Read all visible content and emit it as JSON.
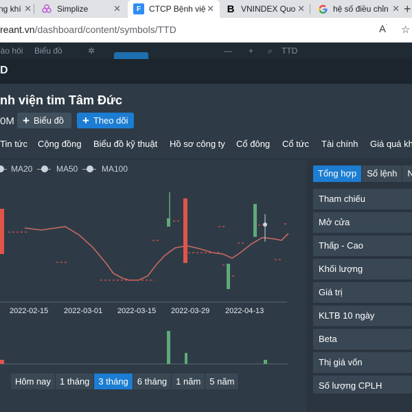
{
  "browser": {
    "tabs": [
      {
        "label": "ng khí",
        "icon": "document-icon",
        "active": false
      },
      {
        "label": "Simplize",
        "icon": "simplize-logo-icon",
        "active": false
      },
      {
        "label": "CTCP Bệnh việ",
        "icon": "f-logo-icon",
        "active": true
      },
      {
        "label": "VNINDEX Quo",
        "icon": "b-logo-icon",
        "active": false
      },
      {
        "label": "hệ số điều chỉn",
        "icon": "google-logo-icon",
        "active": false
      }
    ],
    "url_host": "reant.vn",
    "url_path": "/dashboard/content/symbols/TTD"
  },
  "app_top": {
    "left_text": "nào hôi",
    "right_text": "Biểu đồ",
    "search_text": "TTD"
  },
  "modal": {
    "code_fragment": "D",
    "company_name": "nh viện tim Tâm Đức",
    "price_fragment": "0M",
    "chart_button": "Biểu đồ",
    "follow_button": "Theo dõi",
    "nav": [
      "Tin tức",
      "Cộng đồng",
      "Biểu đồ kỹ thuật",
      "Hồ sơ công ty",
      "Cổ đông",
      "Cổ tức",
      "Tài chính",
      "Giá quá kh"
    ],
    "legend": [
      "MA20",
      "MA50",
      "MA100"
    ],
    "ranges": [
      {
        "label": "Hôm nay",
        "active": false
      },
      {
        "label": "1 tháng",
        "active": false
      },
      {
        "label": "3 tháng",
        "active": true
      },
      {
        "label": "6 tháng",
        "active": false
      },
      {
        "label": "1 năm",
        "active": false
      },
      {
        "label": "5 năm",
        "active": false
      }
    ],
    "right_tabs": [
      {
        "label": "Tổng hợp",
        "active": true
      },
      {
        "label": "Sổ lệnh",
        "active": false
      },
      {
        "label": "N",
        "active": false
      }
    ],
    "stats": [
      "Tham chiếu",
      "Mở cửa",
      "Thấp - Cao",
      "Khối lượng",
      "Giá trị",
      "KLTB 10 ngày",
      "Beta",
      "Thị giá vốn",
      "Số lượng CPLH"
    ]
  },
  "chart_data": {
    "type": "candlestick",
    "x_tick_labels": [
      "2022-02-15",
      "2022-03-01",
      "2022-03-15",
      "2022-03-29",
      "2022-04-13"
    ],
    "colors": {
      "up": "#5faa77",
      "down": "#e0544a",
      "ma": "#c96a63",
      "grid": "#3d4a55"
    }
  }
}
